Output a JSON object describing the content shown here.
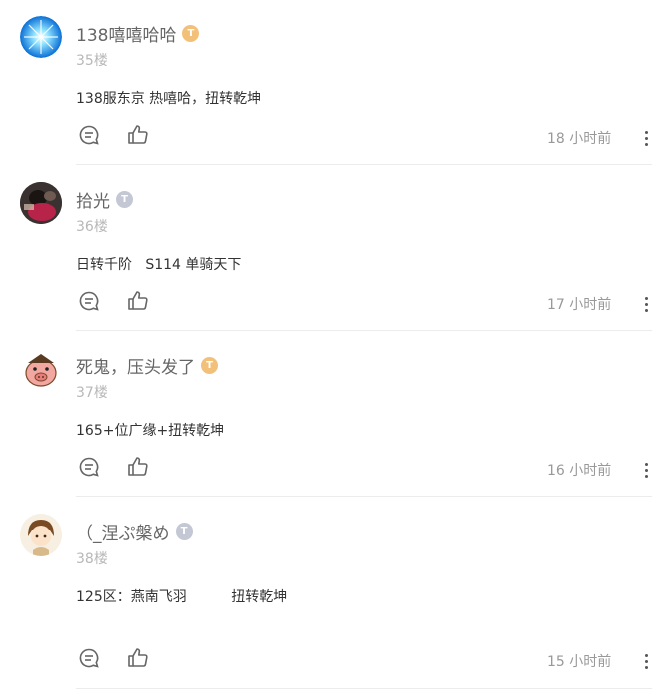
{
  "comments": [
    {
      "username": "138嘻嘻哈哈",
      "badge": "gold",
      "floor": "35楼",
      "content": "138服东京 热嘻哈，扭转乾坤",
      "time": "18 小时前",
      "avatar": "blue-sparkle"
    },
    {
      "username": "拾光",
      "badge": "silver",
      "floor": "36楼",
      "content": "日转千阶   S114 单骑天下",
      "time": "17 小时前",
      "avatar": "dark-photo"
    },
    {
      "username": "死鬼，压头发了",
      "badge": "gold",
      "floor": "37楼",
      "content": "165+位广缘+扭转乾坤",
      "time": "16 小时前",
      "avatar": "pig-cartoon"
    },
    {
      "username": "（_涅ぷ槃め",
      "badge": "silver",
      "floor": "38楼",
      "content": "125区：燕南飞羽          扭转乾坤",
      "time": "15 小时前",
      "avatar": "anime-boy"
    }
  ],
  "colors": {
    "gold_badge": "#f3c07a",
    "silver_badge": "#c3c8d4"
  },
  "icons": {
    "reply": "comment-bubble-icon",
    "like": "thumbs-up-icon",
    "more": "more-vertical-icon"
  }
}
